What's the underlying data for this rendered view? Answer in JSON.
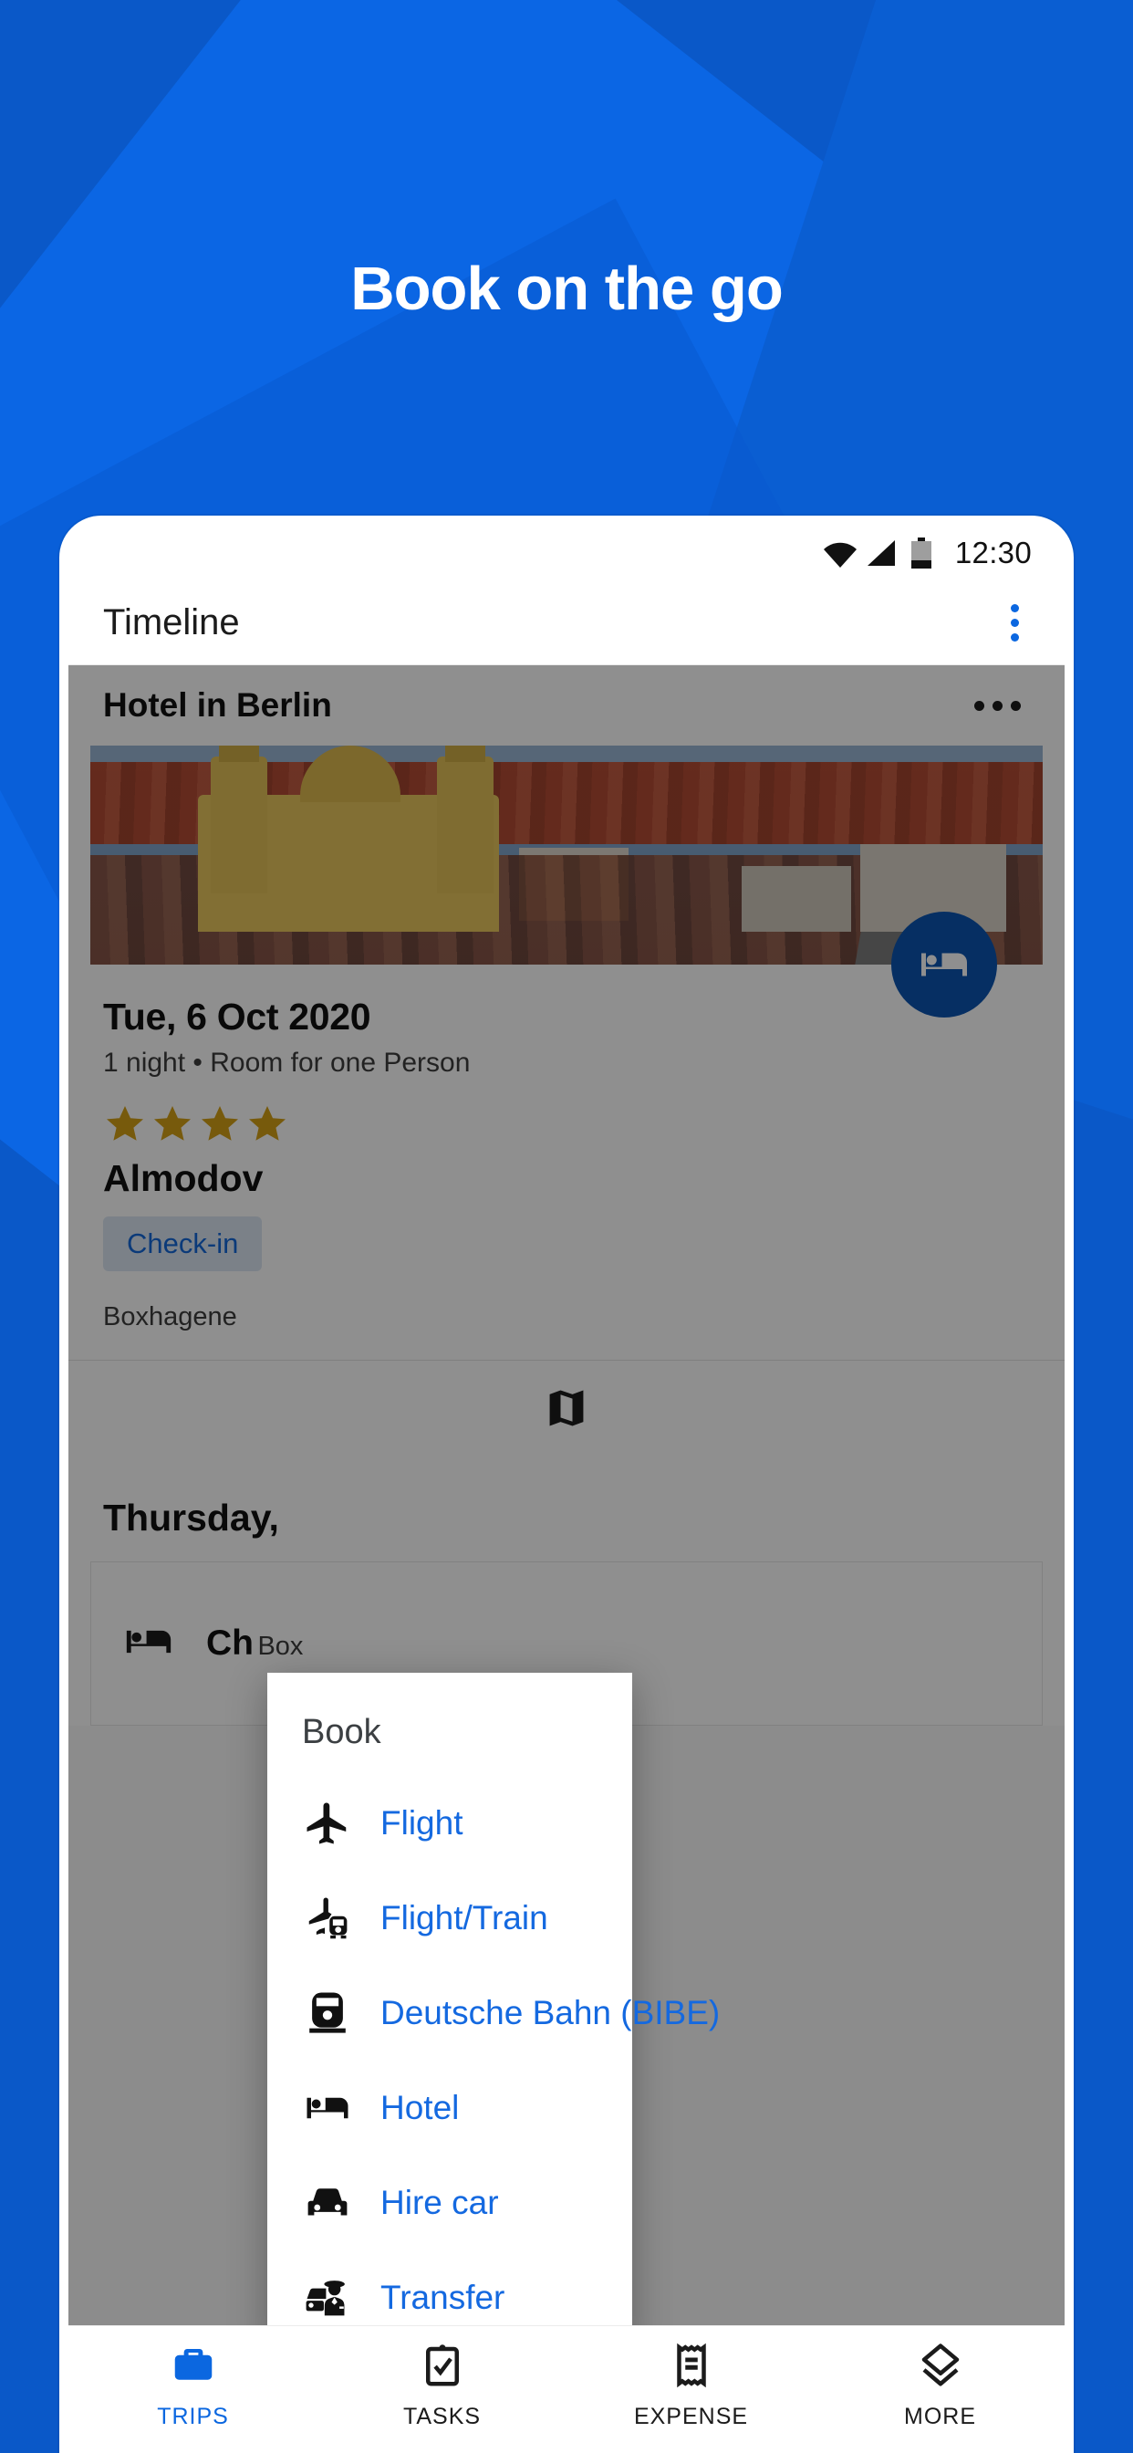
{
  "hero": {
    "headline": "Book on the go"
  },
  "phone": {
    "statusbar": {
      "time": "12:30",
      "wifi_icon": "wifi-icon",
      "signal_icon": "signal-icon",
      "battery_icon": "battery-icon"
    },
    "appbar": {
      "title": "Timeline",
      "overflow_icon": "kebab-menu-icon"
    },
    "trip_card": {
      "header_title": "Hotel in Berlin",
      "overflow_icon": "more-horizontal-icon",
      "image_alt": "berlin-cityscape-photo",
      "fab_icon": "hotel-bed-icon",
      "date": "Tue, 6 Oct 2020",
      "details": "1 night • Room for one Person",
      "star_rating": 4,
      "star_color": "#d4a017",
      "hotel_name": "Almodov",
      "check_in_chip": "Check-in",
      "address": "Boxhagene",
      "action_icons": [
        "map-icon"
      ]
    },
    "day_section": {
      "day_title": "Thursday,",
      "item": {
        "icon": "hotel-bed-icon",
        "line1": "Ch",
        "line2": "Box"
      }
    },
    "dialog": {
      "title": "Book",
      "items": [
        {
          "label": "Flight",
          "icon": "airplane-icon"
        },
        {
          "label": "Flight/Train",
          "icon": "airplane-train-icon"
        },
        {
          "label": "Deutsche Bahn (BIBE)",
          "icon": "train-icon"
        },
        {
          "label": "Hotel",
          "icon": "hotel-bed-icon"
        },
        {
          "label": "Hire car",
          "icon": "car-icon"
        },
        {
          "label": "Transfer",
          "icon": "chauffeur-icon"
        }
      ]
    },
    "bottom_nav": [
      {
        "label": "TRIPS",
        "icon": "briefcase-icon",
        "active": true
      },
      {
        "label": "TASKS",
        "icon": "clipboard-check-icon",
        "active": false
      },
      {
        "label": "EXPENSE",
        "icon": "receipt-icon",
        "active": false
      },
      {
        "label": "MORE",
        "icon": "layers-icon",
        "active": false
      }
    ]
  },
  "colors": {
    "brand_blue": "#0a58c8",
    "accent_blue": "#0b67e0",
    "link_blue": "#1469e0",
    "star_gold": "#d4a017"
  }
}
